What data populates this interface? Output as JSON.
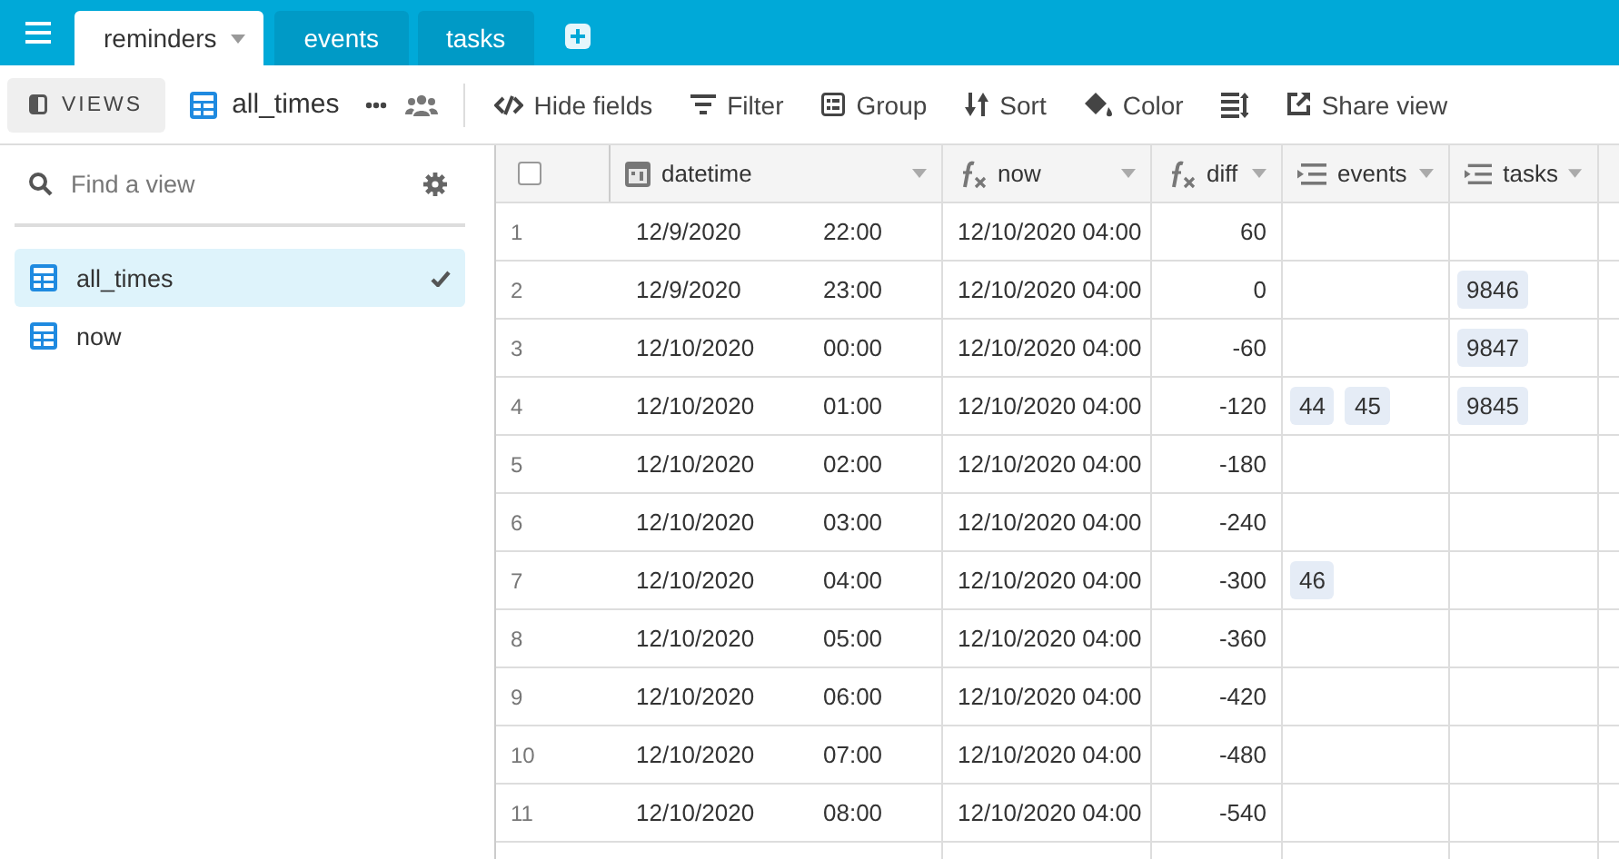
{
  "top_bar": {
    "tabs": [
      {
        "label": "reminders",
        "selected": true
      },
      {
        "label": "events",
        "selected": false
      },
      {
        "label": "tasks",
        "selected": false
      }
    ]
  },
  "toolbar": {
    "views_button": "VIEWS",
    "view_name": "all_times",
    "actions": [
      {
        "kind": "hide",
        "label": "Hide fields"
      },
      {
        "kind": "filter",
        "label": "Filter"
      },
      {
        "kind": "group",
        "label": "Group"
      },
      {
        "kind": "sort",
        "label": "Sort"
      },
      {
        "kind": "color",
        "label": "Color"
      },
      {
        "kind": "row_height"
      },
      {
        "kind": "share",
        "label": "Share view"
      }
    ]
  },
  "sidebar": {
    "search": {
      "placeholder": "Find a view"
    },
    "views": [
      {
        "name": "all_times",
        "selected": true
      },
      {
        "name": "now",
        "selected": false
      }
    ]
  },
  "grid": {
    "select_all": {
      "checked": false
    },
    "columns": [
      {
        "kind": "date",
        "name": "datetime"
      },
      {
        "kind": "formula",
        "name": "now"
      },
      {
        "kind": "formula",
        "name": "diff"
      },
      {
        "kind": "link",
        "name": "events"
      },
      {
        "kind": "link",
        "name": "tasks"
      }
    ],
    "rows": [
      {
        "number": "1",
        "date": "12/9/2020",
        "time": "22:00",
        "now": "12/10/2020 04:00",
        "diff": "60"
      },
      {
        "number": "2",
        "date": "12/9/2020",
        "time": "23:00",
        "now": "12/10/2020 04:00",
        "diff": "0",
        "tasks": [
          "9846"
        ]
      },
      {
        "number": "3",
        "date": "12/10/2020",
        "time": "00:00",
        "now": "12/10/2020 04:00",
        "diff": "-60",
        "tasks": [
          "9847"
        ]
      },
      {
        "number": "4",
        "date": "12/10/2020",
        "time": "01:00",
        "now": "12/10/2020 04:00",
        "diff": "-120",
        "events": [
          "44",
          "45"
        ],
        "tasks": [
          "9845"
        ]
      },
      {
        "number": "5",
        "date": "12/10/2020",
        "time": "02:00",
        "now": "12/10/2020 04:00",
        "diff": "-180"
      },
      {
        "number": "6",
        "date": "12/10/2020",
        "time": "03:00",
        "now": "12/10/2020 04:00",
        "diff": "-240"
      },
      {
        "number": "7",
        "date": "12/10/2020",
        "time": "04:00",
        "now": "12/10/2020 04:00",
        "diff": "-300",
        "events": [
          "46"
        ]
      },
      {
        "number": "8",
        "date": "12/10/2020",
        "time": "05:00",
        "now": "12/10/2020 04:00",
        "diff": "-360"
      },
      {
        "number": "9",
        "date": "12/10/2020",
        "time": "06:00",
        "now": "12/10/2020 04:00",
        "diff": "-420"
      },
      {
        "number": "10",
        "date": "12/10/2020",
        "time": "07:00",
        "now": "12/10/2020 04:00",
        "diff": "-480"
      },
      {
        "number": "11",
        "date": "12/10/2020",
        "time": "08:00",
        "now": "12/10/2020 04:00",
        "diff": "-540"
      }
    ]
  }
}
